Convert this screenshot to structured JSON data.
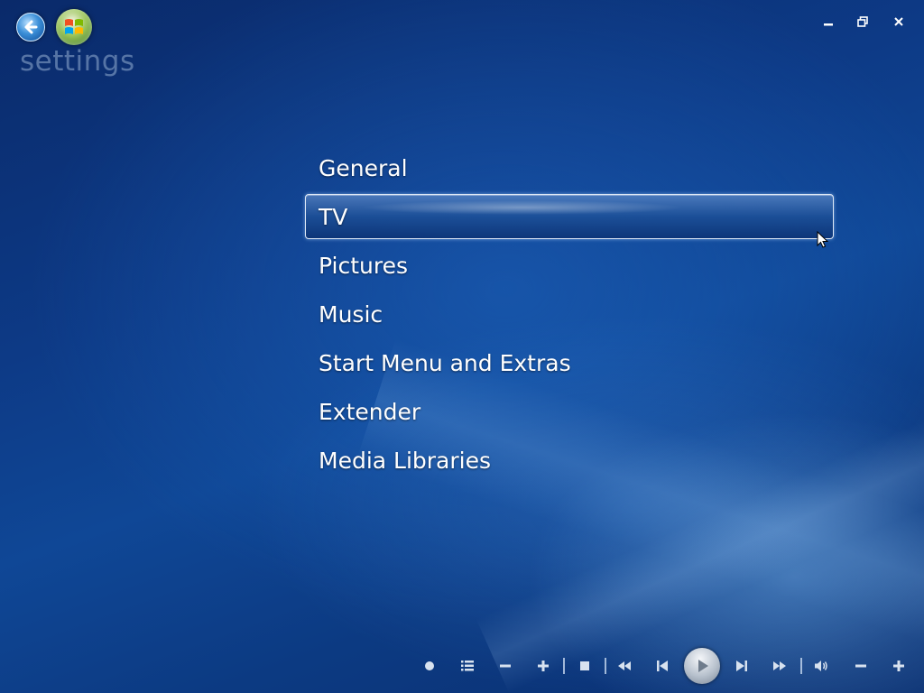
{
  "header": {
    "title": "settings",
    "back_icon": "back-arrow-icon",
    "start_icon": "windows-start-orb-icon"
  },
  "window_controls": {
    "minimize_icon": "minimize-icon",
    "restore_icon": "restore-icon",
    "close_icon": "close-icon"
  },
  "menu": {
    "selected_index": 1,
    "items": [
      {
        "label": "General"
      },
      {
        "label": "TV"
      },
      {
        "label": "Pictures"
      },
      {
        "label": "Music"
      },
      {
        "label": "Start Menu and Extras"
      },
      {
        "label": "Extender"
      },
      {
        "label": "Media Libraries"
      }
    ]
  },
  "transport": {
    "buttons": [
      "record-icon",
      "guide-icon",
      "channel-down-icon",
      "channel-up-icon",
      "stop-icon",
      "rewind-icon",
      "skip-back-icon",
      "play-icon",
      "skip-forward-icon",
      "fast-forward-icon",
      "mute-icon",
      "volume-down-icon",
      "volume-up-icon"
    ]
  },
  "colors": {
    "background": "#0d3a86",
    "text": "#ffffff",
    "heading": "#96afd2",
    "selection_border": "#dfe9f7"
  }
}
